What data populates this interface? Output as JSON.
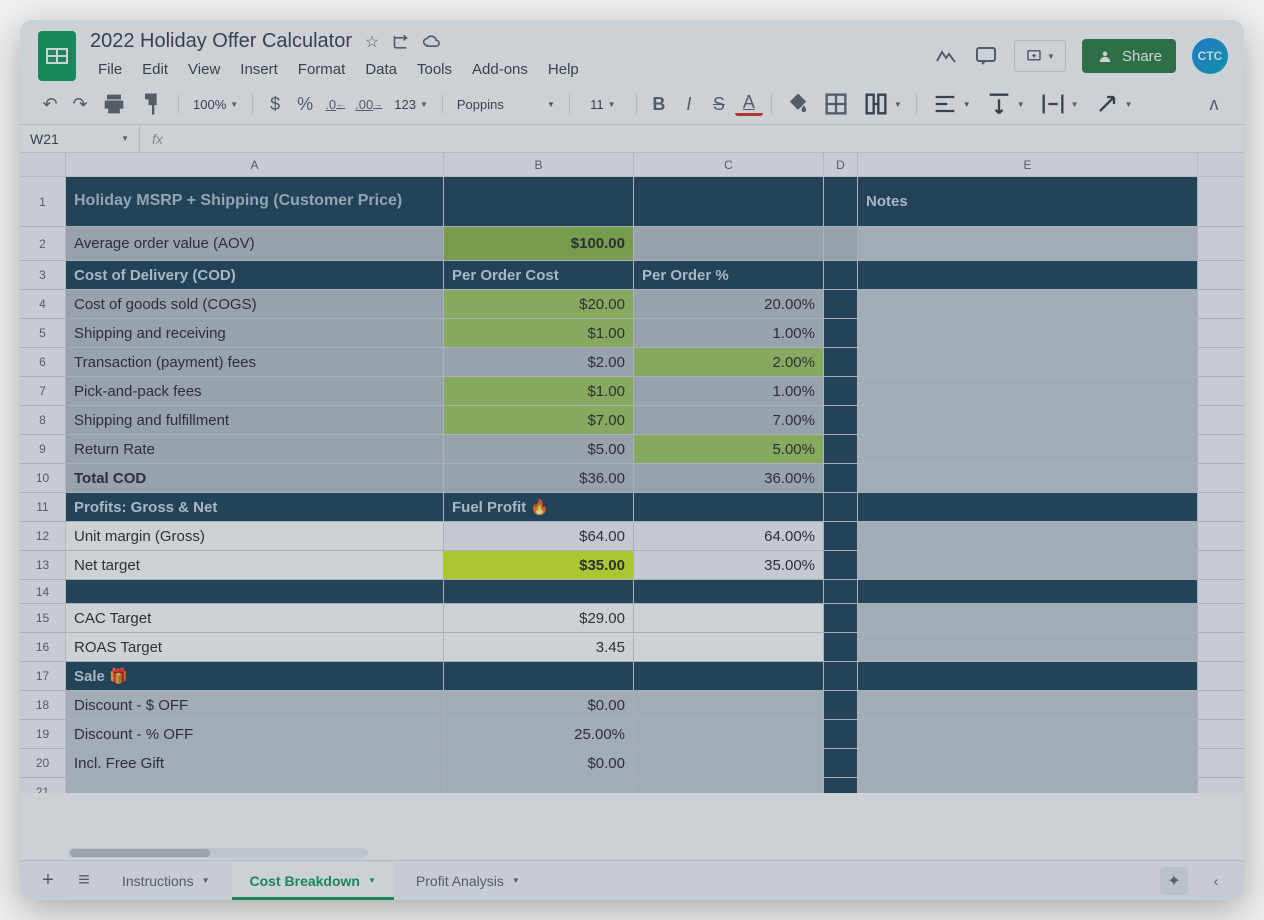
{
  "doc": {
    "title": "2022 Holiday Offer Calculator"
  },
  "menus": {
    "file": "File",
    "edit": "Edit",
    "view": "View",
    "insert": "Insert",
    "format": "Format",
    "data": "Data",
    "tools": "Tools",
    "addons": "Add-ons",
    "help": "Help"
  },
  "toolbar": {
    "zoom": "100%",
    "font": "Poppins",
    "size": "11",
    "currency": "$",
    "percent": "%",
    "dec_dec": ".0",
    "dec_inc": ".00",
    "numfmt": "123"
  },
  "share": {
    "label": "Share"
  },
  "namebox": "W21",
  "avatar": "CTC",
  "columns": {
    "A": "A",
    "B": "B",
    "C": "C",
    "D": "D",
    "E": "E"
  },
  "sheet": {
    "header1_a": "Holiday MSRP + Shipping (Customer Price)",
    "header1_e": "Notes",
    "r2": {
      "a": "Average order value (AOV)",
      "b": "$100.00"
    },
    "header3_a": "Cost of Delivery (COD)",
    "header3_b": "Per Order Cost",
    "header3_c": "Per Order %",
    "r4": {
      "a": "Cost of goods sold (COGS)",
      "b": "$20.00",
      "c": "20.00%"
    },
    "r5": {
      "a": "Shipping and receiving",
      "b": "$1.00",
      "c": "1.00%"
    },
    "r6": {
      "a": "Transaction (payment) fees",
      "b": "$2.00",
      "c": "2.00%"
    },
    "r7": {
      "a": "Pick-and-pack fees",
      "b": "$1.00",
      "c": "1.00%"
    },
    "r8": {
      "a": "Shipping and fulfillment",
      "b": "$7.00",
      "c": "7.00%"
    },
    "r9": {
      "a": "Return Rate",
      "b": "$5.00",
      "c": "5.00%"
    },
    "r10": {
      "a": "Total COD",
      "b": "$36.00",
      "c": "36.00%"
    },
    "header11_a": "Profits: Gross & Net",
    "header11_b": "Fuel Profit 🔥",
    "r12": {
      "a": "Unit margin (Gross)",
      "b": "$64.00",
      "c": "64.00%"
    },
    "r13": {
      "a": "Net target",
      "b": "$35.00",
      "c": "35.00%"
    },
    "r15": {
      "a": "CAC Target",
      "b": "$29.00"
    },
    "r16": {
      "a": "ROAS Target",
      "b": "3.45"
    },
    "header17_a": "Sale 🎁",
    "r18": {
      "a": "Discount - $ OFF",
      "b": "$0.00"
    },
    "r19": {
      "a": "Discount - % OFF",
      "b": "25.00%"
    },
    "r20": {
      "a": "Incl. Free Gift",
      "b": "$0.00"
    }
  },
  "tabs": {
    "instructions": "Instructions",
    "cost": "Cost Breakdown",
    "profit": "Profit Analysis"
  }
}
